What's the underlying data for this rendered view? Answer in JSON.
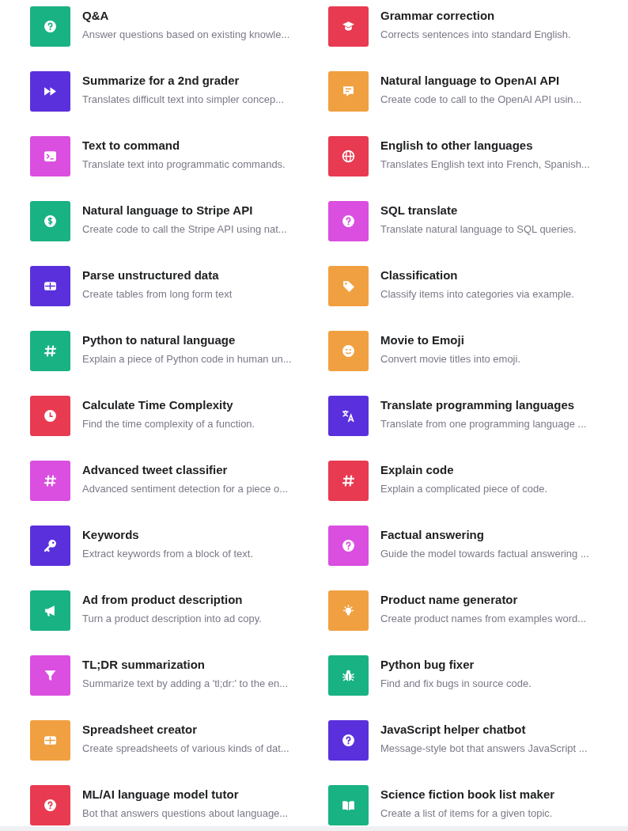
{
  "examples": [
    {
      "title": "Q&A",
      "description": "Answer questions based on existing knowle...",
      "kind": "question",
      "color": "#19b283"
    },
    {
      "title": "Grammar correction",
      "description": "Corrects sentences into standard English.",
      "kind": "cap",
      "color": "#e83a50"
    },
    {
      "title": "Summarize for a 2nd grader",
      "description": "Translates difficult text into simpler concep...",
      "kind": "forward",
      "color": "#5a30dc"
    },
    {
      "title": "Natural language to OpenAI API",
      "description": "Create code to call to the OpenAI API usin...",
      "kind": "chat",
      "color": "#f0a040"
    },
    {
      "title": "Text to command",
      "description": "Translate text into programmatic commands.",
      "kind": "terminal",
      "color": "#da4ee0"
    },
    {
      "title": "English to other languages",
      "description": "Translates English text into French, Spanish...",
      "kind": "globe",
      "color": "#e83a50"
    },
    {
      "title": "Natural language to Stripe API",
      "description": "Create code to call the Stripe API using nat...",
      "kind": "dollar",
      "color": "#19b283"
    },
    {
      "title": "SQL translate",
      "description": "Translate natural language to SQL queries.",
      "kind": "question",
      "color": "#da4ee0"
    },
    {
      "title": "Parse unstructured data",
      "description": "Create tables from long form text",
      "kind": "table",
      "color": "#5a30dc"
    },
    {
      "title": "Classification",
      "description": "Classify items into categories via example.",
      "kind": "tag",
      "color": "#f0a040"
    },
    {
      "title": "Python to natural language",
      "description": "Explain a piece of Python code in human un...",
      "kind": "hash",
      "color": "#19b283"
    },
    {
      "title": "Movie to Emoji",
      "description": "Convert movie titles into emoji.",
      "kind": "smile",
      "color": "#f0a040"
    },
    {
      "title": "Calculate Time Complexity",
      "description": "Find the time complexity of a function.",
      "kind": "clock",
      "color": "#e83a50"
    },
    {
      "title": "Translate programming languages",
      "description": "Translate from one programming language ...",
      "kind": "translate",
      "color": "#5a30dc"
    },
    {
      "title": "Advanced tweet classifier",
      "description": "Advanced sentiment detection for a piece o...",
      "kind": "hash",
      "color": "#da4ee0"
    },
    {
      "title": "Explain code",
      "description": "Explain a complicated piece of code.",
      "kind": "hash",
      "color": "#e83a50"
    },
    {
      "title": "Keywords",
      "description": "Extract keywords from a block of text.",
      "kind": "key",
      "color": "#5a30dc"
    },
    {
      "title": "Factual answering",
      "description": "Guide the model towards factual answering ...",
      "kind": "question",
      "color": "#da4ee0"
    },
    {
      "title": "Ad from product description",
      "description": "Turn a product description into ad copy.",
      "kind": "megaphone",
      "color": "#19b283"
    },
    {
      "title": "Product name generator",
      "description": "Create product names from examples word...",
      "kind": "bulb",
      "color": "#f0a040"
    },
    {
      "title": "TL;DR summarization",
      "description": "Summarize text by adding a 'tl;dr:' to the en...",
      "kind": "funnel",
      "color": "#da4ee0"
    },
    {
      "title": "Python bug fixer",
      "description": "Find and fix bugs in source code.",
      "kind": "bug",
      "color": "#19b283"
    },
    {
      "title": "Spreadsheet creator",
      "description": "Create spreadsheets of various kinds of dat...",
      "kind": "table",
      "color": "#f0a040"
    },
    {
      "title": "JavaScript helper chatbot",
      "description": "Message-style bot that answers JavaScript ...",
      "kind": "question",
      "color": "#5a30dc"
    },
    {
      "title": "ML/AI language model tutor",
      "description": "Bot that answers questions about language...",
      "kind": "question",
      "color": "#e83a50"
    },
    {
      "title": "Science fiction book list maker",
      "description": "Create a list of items for a given topic.",
      "kind": "book",
      "color": "#19b283"
    }
  ]
}
